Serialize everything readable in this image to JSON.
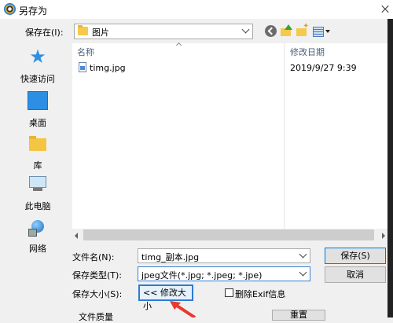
{
  "window": {
    "title": "另存为"
  },
  "toolbar": {
    "save_in_label": "保存在(I):",
    "location": "图片"
  },
  "sidebar": {
    "items": [
      {
        "label": "快速访问",
        "icon": "star-icon"
      },
      {
        "label": "桌面",
        "icon": "desktop-icon"
      },
      {
        "label": "库",
        "icon": "library-icon"
      },
      {
        "label": "此电脑",
        "icon": "computer-icon"
      },
      {
        "label": "网络",
        "icon": "network-icon"
      }
    ]
  },
  "filelist": {
    "columns": [
      "名称",
      "修改日期"
    ],
    "files": [
      {
        "name": "timg.jpg",
        "date": "2019/9/27 9:39"
      }
    ]
  },
  "form": {
    "filename_label": "文件名(N):",
    "filename_value": "timg_副本.jpg",
    "type_label": "保存类型(T):",
    "type_value": "jpeg文件(*.jpg; *.jpeg; *.jpe)",
    "size_label": "保存大小(S):",
    "resize_label": "<< 修改大小",
    "remove_exif_label": "删除Exif信息",
    "quality_label": "文件质量",
    "reset_label": "重置"
  },
  "buttons": {
    "save": "保存(S)",
    "cancel": "取消"
  },
  "colors": {
    "accent": "#0078d7",
    "annotation_arrow": "#e8392e"
  }
}
